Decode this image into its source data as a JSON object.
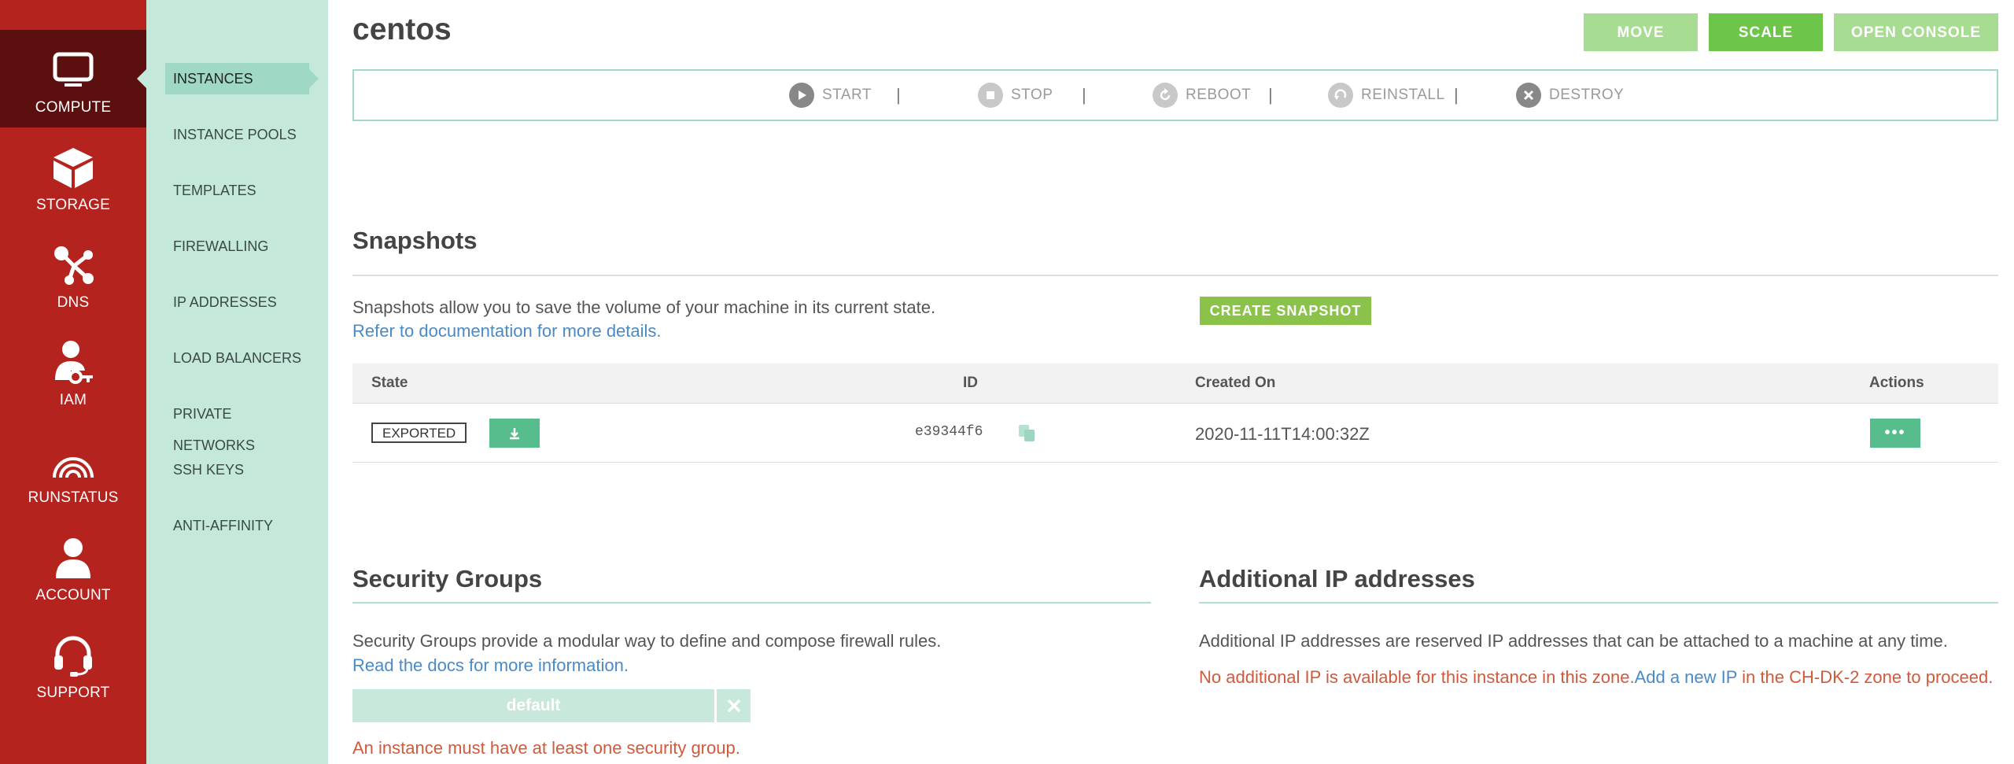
{
  "rail": {
    "items": [
      {
        "label": "COMPUTE",
        "icon": "monitor-icon",
        "active": true
      },
      {
        "label": "STORAGE",
        "icon": "cube-icon"
      },
      {
        "label": "DNS",
        "icon": "network-icon"
      },
      {
        "label": "IAM",
        "icon": "user-key-icon"
      },
      {
        "label": "RUNSTATUS",
        "icon": "signal-icon"
      },
      {
        "label": "ACCOUNT",
        "icon": "person-icon"
      },
      {
        "label": "SUPPORT",
        "icon": "headset-icon"
      }
    ]
  },
  "subnav": {
    "items": [
      {
        "label": "INSTANCES",
        "active": true
      },
      {
        "label": "INSTANCE POOLS"
      },
      {
        "label": "TEMPLATES"
      },
      {
        "label": "FIREWALLING"
      },
      {
        "label": "IP ADDRESSES"
      },
      {
        "label": "LOAD BALANCERS"
      },
      {
        "label": "PRIVATE NETWORKS"
      },
      {
        "label": "SSH KEYS"
      },
      {
        "label": "ANTI-AFFINITY"
      }
    ]
  },
  "header": {
    "title": "centos",
    "move_label": "MOVE",
    "scale_label": "SCALE",
    "console_label": "OPEN CONSOLE"
  },
  "actions": {
    "start": "START",
    "stop": "STOP",
    "reboot": "REBOOT",
    "reinstall": "REINSTALL",
    "destroy": "DESTROY",
    "separator": "|"
  },
  "snapshots": {
    "heading": "Snapshots",
    "description": "Snapshots allow you to save the volume of your machine in its current state.",
    "doc_link": "Refer to documentation for more details.",
    "create_label": "CREATE SNAPSHOT",
    "columns": {
      "state": "State",
      "id": "ID",
      "created": "Created On",
      "actions": "Actions"
    },
    "rows": [
      {
        "state": "EXPORTED",
        "id": "e39344f6",
        "created": "2020-11-11T14:00:32Z",
        "more": "•••"
      }
    ]
  },
  "security_groups": {
    "heading": "Security Groups",
    "description": "Security Groups provide a modular way to define and compose firewall rules.",
    "doc_link": "Read the docs for more information.",
    "group": "default",
    "warning": "An instance must have at least one security group."
  },
  "additional_ips": {
    "heading": "Additional IP addresses",
    "description": "Additional IP addresses are reserved IP addresses that can be attached to a machine at any time.",
    "msg_pre": "No additional IP is available for this instance in this zone.",
    "msg_link": "Add a new IP",
    "msg_post": " in the CH-DK-2 zone to proceed."
  },
  "colors": {
    "rail": "#b5231f",
    "rail_active": "#5b0f0e",
    "subnav": "#c4e8da",
    "accent_green": "#6dc54a",
    "link": "#4a8ac6",
    "error": "#d05a3c"
  }
}
